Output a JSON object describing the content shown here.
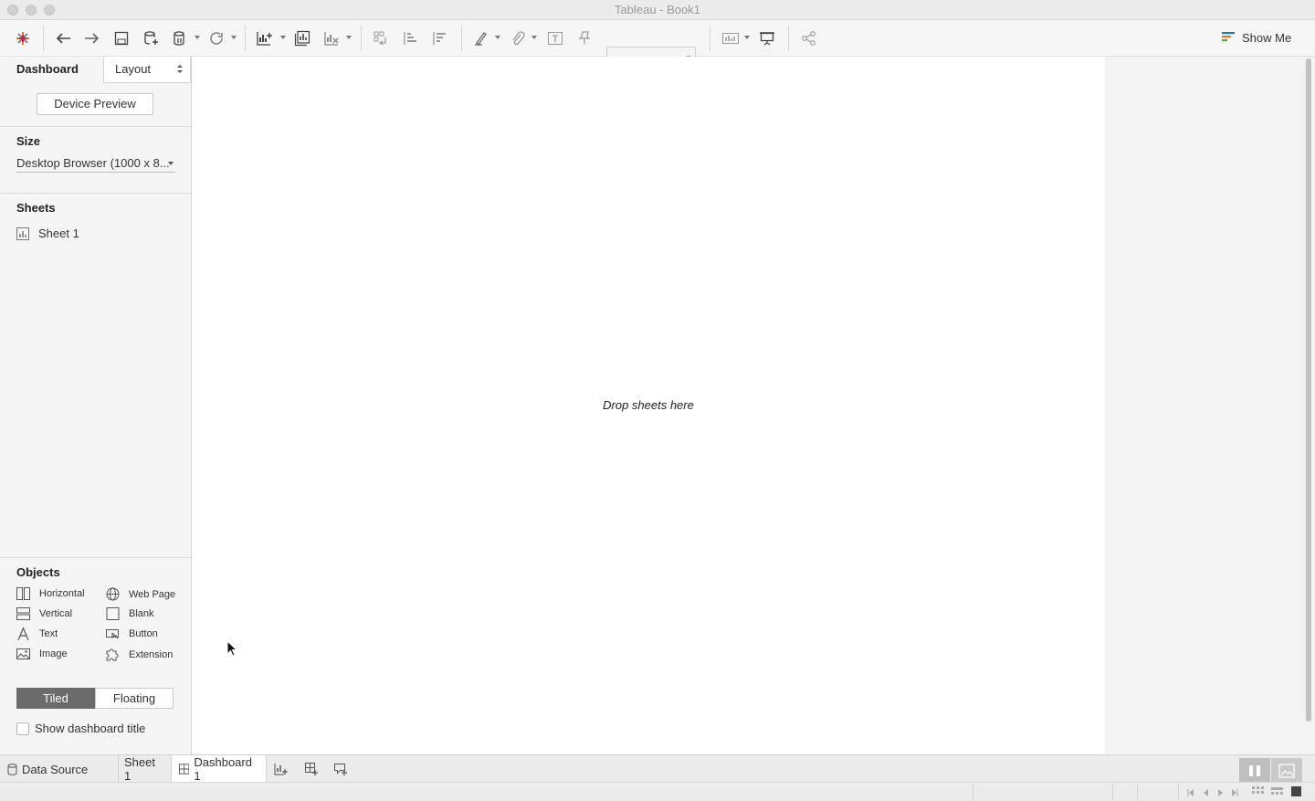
{
  "window": {
    "title": "Tableau - Book1"
  },
  "toolbar": {
    "show_me_label": "Show Me"
  },
  "left_pane": {
    "tabs": {
      "dashboard": "Dashboard",
      "layout": "Layout"
    },
    "device_preview_label": "Device Preview",
    "size": {
      "title": "Size",
      "value": "Desktop Browser (1000 x 8..."
    },
    "sheets": {
      "title": "Sheets",
      "items": [
        "Sheet 1"
      ]
    },
    "objects": {
      "title": "Objects",
      "items": [
        "Horizontal",
        "Web Page",
        "Vertical",
        "Blank",
        "Text",
        "Button",
        "Image",
        "Extension"
      ]
    },
    "mode": {
      "tiled": "Tiled",
      "floating": "Floating",
      "selected": "Tiled"
    },
    "show_title_label": "Show dashboard title"
  },
  "canvas": {
    "drop_text": "Drop sheets here"
  },
  "sheet_tabs": {
    "data_source": "Data Source",
    "sheet1": "Sheet 1",
    "dashboard1": "Dashboard 1",
    "active": "Dashboard 1"
  },
  "colors": {
    "tiled_bg": "#6b6b6b",
    "accent": "#1f77b4"
  }
}
